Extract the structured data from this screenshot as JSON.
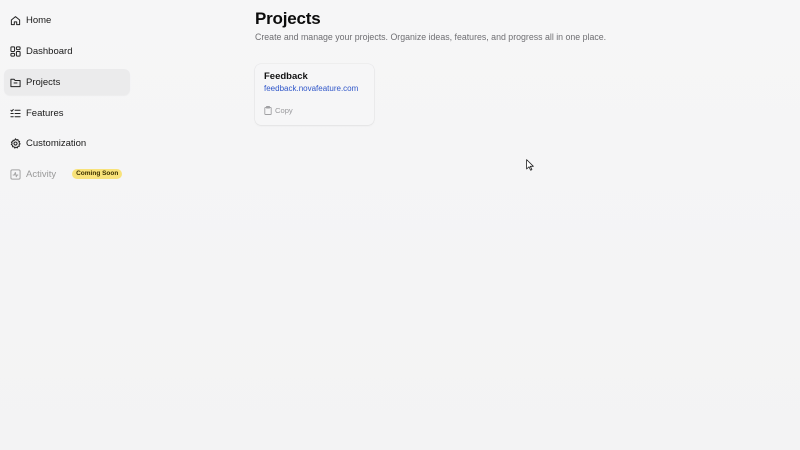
{
  "sidebar": {
    "items": [
      {
        "label": "Home",
        "icon": "home-icon"
      },
      {
        "label": "Dashboard",
        "icon": "dashboard-grid-icon"
      },
      {
        "label": "Projects",
        "icon": "folder-icon",
        "active": true
      },
      {
        "label": "Features",
        "icon": "list-check-icon"
      },
      {
        "label": "Customization",
        "icon": "gear-icon"
      },
      {
        "label": "Activity",
        "icon": "activity-icon",
        "disabled": true,
        "badge": "Coming Soon"
      }
    ]
  },
  "main": {
    "title": "Projects",
    "subtitle": "Create and manage your projects. Organize ideas, features, and progress all in one place.",
    "projects": [
      {
        "name": "Feedback",
        "url": "feedback.novafeature.com",
        "copy_label": "Copy"
      }
    ]
  },
  "colors": {
    "background": "#f5f5f6",
    "link": "#2f56c9",
    "badge": "#f8e27a",
    "active_nav": "#ebebec"
  }
}
